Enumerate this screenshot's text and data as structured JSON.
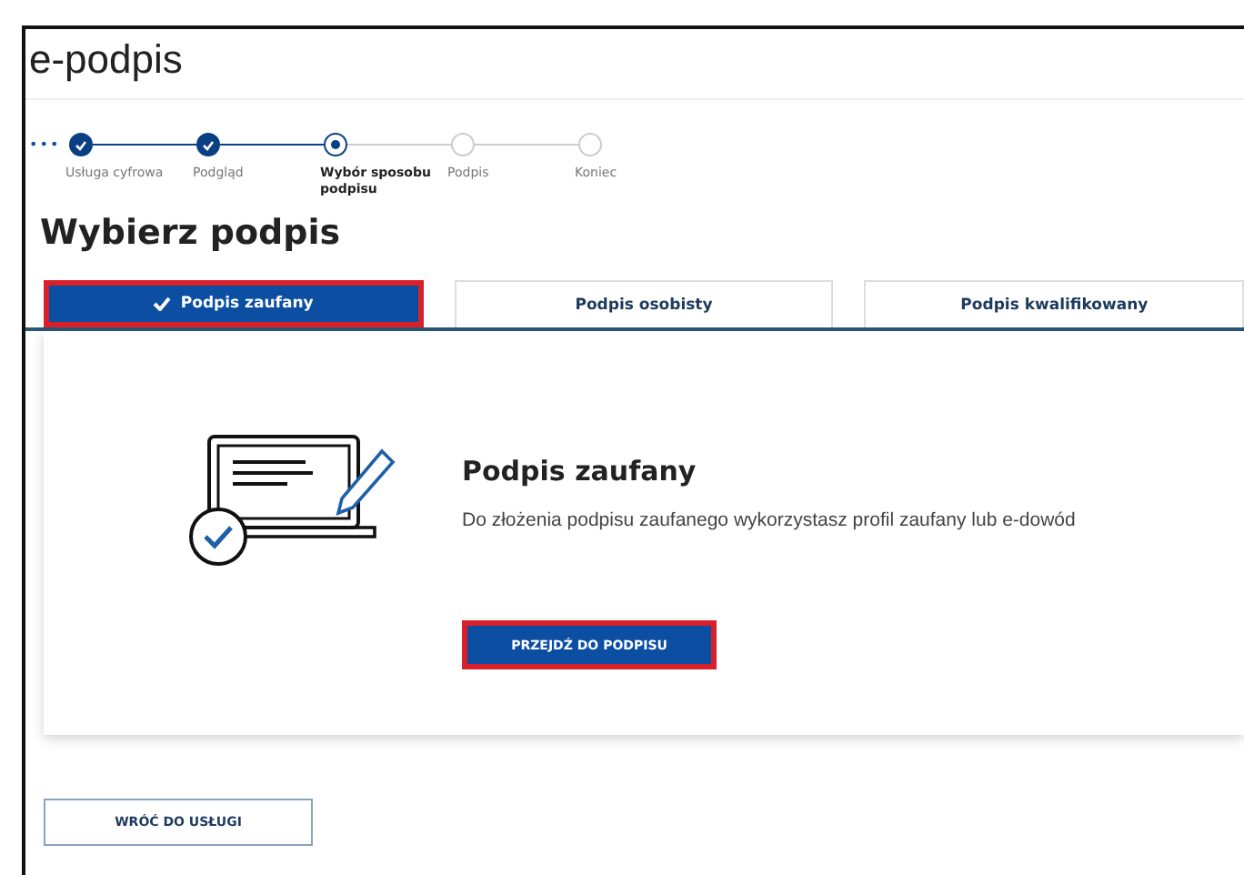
{
  "app_title": "e-podpis",
  "steps_more": "•••",
  "steps": [
    {
      "label": "Usługa cyfrowa",
      "kind": "done"
    },
    {
      "label": "Podgląd",
      "kind": "done"
    },
    {
      "label": "Wybór sposobu podpisu",
      "kind": "current"
    },
    {
      "label": "Podpis",
      "kind": "pending"
    },
    {
      "label": "Koniec",
      "kind": "pending"
    }
  ],
  "heading": "Wybierz podpis",
  "tabs": [
    {
      "label": "Podpis zaufany",
      "selected": true,
      "highlighted": true
    },
    {
      "label": "Podpis osobisty",
      "selected": false,
      "highlighted": false
    },
    {
      "label": "Podpis kwalifikowany",
      "selected": false,
      "highlighted": false
    }
  ],
  "panel": {
    "title": "Podpis zaufany",
    "description": "Do złożenia podpisu zaufanego wykorzystasz profil zaufany lub e-dowód",
    "button": {
      "label": "PRZEJDŹ DO PODPISU",
      "highlighted": true
    }
  },
  "back_button": "WRÓĆ DO USŁUGI"
}
